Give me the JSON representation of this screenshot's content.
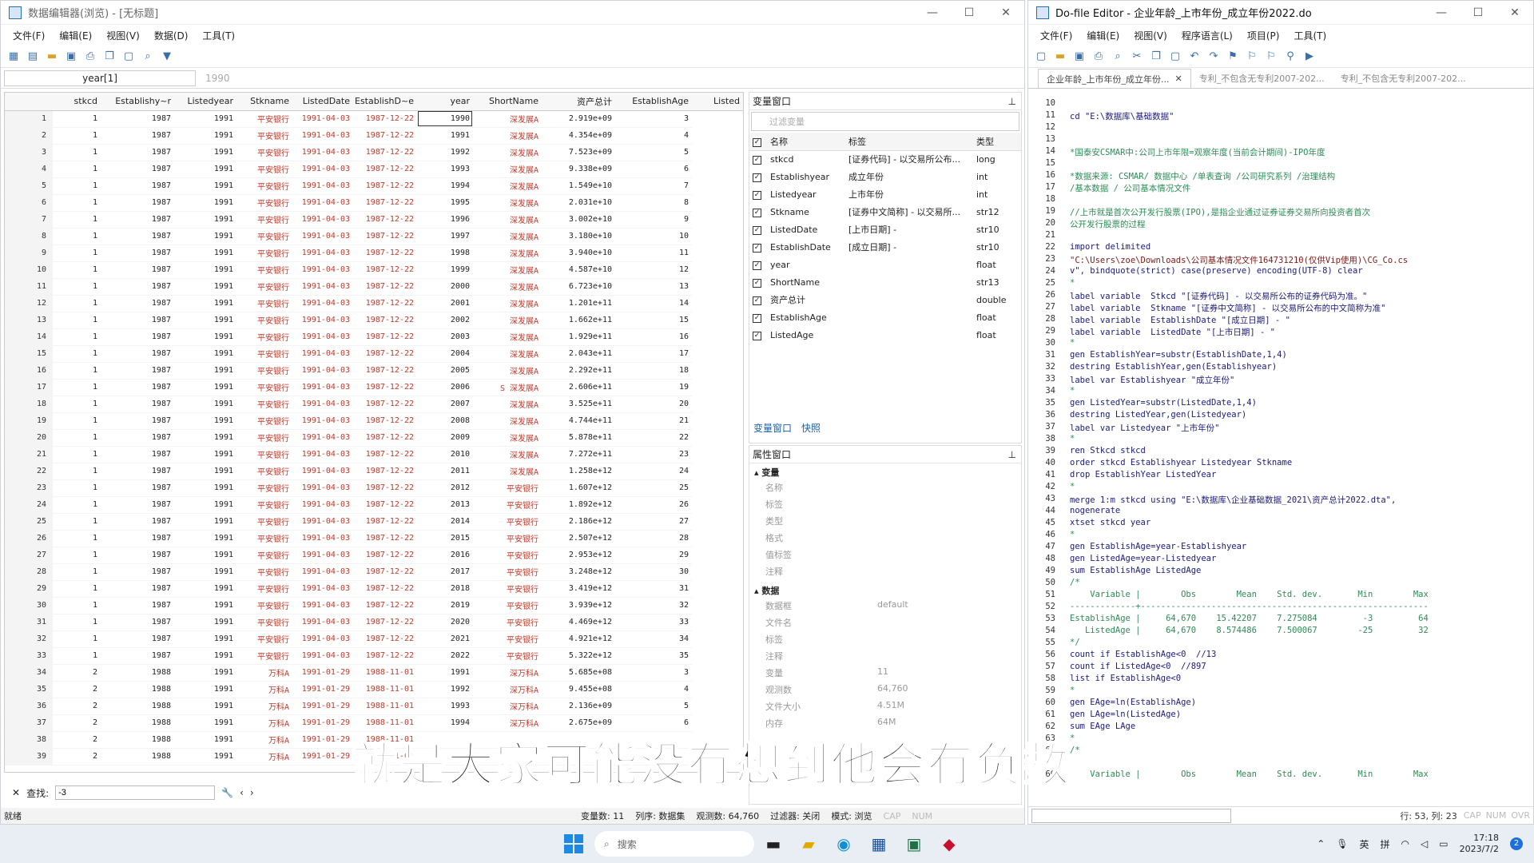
{
  "data_editor": {
    "title": "数据编辑器(浏览) - [无标题]",
    "menu": [
      "文件(F)",
      "编辑(E)",
      "视图(V)",
      "数据(D)",
      "工具(T)"
    ],
    "cell_ref": "year[1]",
    "cell_value": "1990",
    "columns": [
      "stkcd",
      "Establishy~r",
      "Listedyear",
      "Stkname",
      "ListedDate",
      "EstablishD~e",
      "year",
      "ShortName",
      "资产总计",
      "EstablishAge",
      "Listed"
    ],
    "rows": [
      [
        "1",
        "1",
        "1987",
        "1991",
        "平安银行",
        "1991-04-03",
        "1987-12-22",
        "1990",
        "深发展A",
        "2.919e+09",
        "3"
      ],
      [
        "2",
        "1",
        "1987",
        "1991",
        "平安银行",
        "1991-04-03",
        "1987-12-22",
        "1991",
        "深发展A",
        "4.354e+09",
        "4"
      ],
      [
        "3",
        "1",
        "1987",
        "1991",
        "平安银行",
        "1991-04-03",
        "1987-12-22",
        "1992",
        "深发展A",
        "7.523e+09",
        "5"
      ],
      [
        "4",
        "1",
        "1987",
        "1991",
        "平安银行",
        "1991-04-03",
        "1987-12-22",
        "1993",
        "深发展A",
        "9.338e+09",
        "6"
      ],
      [
        "5",
        "1",
        "1987",
        "1991",
        "平安银行",
        "1991-04-03",
        "1987-12-22",
        "1994",
        "深发展A",
        "1.549e+10",
        "7"
      ],
      [
        "6",
        "1",
        "1987",
        "1991",
        "平安银行",
        "1991-04-03",
        "1987-12-22",
        "1995",
        "深发展A",
        "2.031e+10",
        "8"
      ],
      [
        "7",
        "1",
        "1987",
        "1991",
        "平安银行",
        "1991-04-03",
        "1987-12-22",
        "1996",
        "深发展A",
        "3.002e+10",
        "9"
      ],
      [
        "8",
        "1",
        "1987",
        "1991",
        "平安银行",
        "1991-04-03",
        "1987-12-22",
        "1997",
        "深发展A",
        "3.180e+10",
        "10"
      ],
      [
        "9",
        "1",
        "1987",
        "1991",
        "平安银行",
        "1991-04-03",
        "1987-12-22",
        "1998",
        "深发展A",
        "3.940e+10",
        "11"
      ],
      [
        "10",
        "1",
        "1987",
        "1991",
        "平安银行",
        "1991-04-03",
        "1987-12-22",
        "1999",
        "深发展A",
        "4.587e+10",
        "12"
      ],
      [
        "11",
        "1",
        "1987",
        "1991",
        "平安银行",
        "1991-04-03",
        "1987-12-22",
        "2000",
        "深发展A",
        "6.723e+10",
        "13"
      ],
      [
        "12",
        "1",
        "1987",
        "1991",
        "平安银行",
        "1991-04-03",
        "1987-12-22",
        "2001",
        "深发展A",
        "1.201e+11",
        "14"
      ],
      [
        "13",
        "1",
        "1987",
        "1991",
        "平安银行",
        "1991-04-03",
        "1987-12-22",
        "2002",
        "深发展A",
        "1.662e+11",
        "15"
      ],
      [
        "14",
        "1",
        "1987",
        "1991",
        "平安银行",
        "1991-04-03",
        "1987-12-22",
        "2003",
        "深发展A",
        "1.929e+11",
        "16"
      ],
      [
        "15",
        "1",
        "1987",
        "1991",
        "平安银行",
        "1991-04-03",
        "1987-12-22",
        "2004",
        "深发展A",
        "2.043e+11",
        "17"
      ],
      [
        "16",
        "1",
        "1987",
        "1991",
        "平安银行",
        "1991-04-03",
        "1987-12-22",
        "2005",
        "深发展A",
        "2.292e+11",
        "18"
      ],
      [
        "17",
        "1",
        "1987",
        "1991",
        "平安银行",
        "1991-04-03",
        "1987-12-22",
        "2006",
        "S 深发展A",
        "2.606e+11",
        "19"
      ],
      [
        "18",
        "1",
        "1987",
        "1991",
        "平安银行",
        "1991-04-03",
        "1987-12-22",
        "2007",
        "深发展A",
        "3.525e+11",
        "20"
      ],
      [
        "19",
        "1",
        "1987",
        "1991",
        "平安银行",
        "1991-04-03",
        "1987-12-22",
        "2008",
        "深发展A",
        "4.744e+11",
        "21"
      ],
      [
        "20",
        "1",
        "1987",
        "1991",
        "平安银行",
        "1991-04-03",
        "1987-12-22",
        "2009",
        "深发展A",
        "5.878e+11",
        "22"
      ],
      [
        "21",
        "1",
        "1987",
        "1991",
        "平安银行",
        "1991-04-03",
        "1987-12-22",
        "2010",
        "深发展A",
        "7.272e+11",
        "23"
      ],
      [
        "22",
        "1",
        "1987",
        "1991",
        "平安银行",
        "1991-04-03",
        "1987-12-22",
        "2011",
        "深发展A",
        "1.258e+12",
        "24"
      ],
      [
        "23",
        "1",
        "1987",
        "1991",
        "平安银行",
        "1991-04-03",
        "1987-12-22",
        "2012",
        "平安银行",
        "1.607e+12",
        "25"
      ],
      [
        "24",
        "1",
        "1987",
        "1991",
        "平安银行",
        "1991-04-03",
        "1987-12-22",
        "2013",
        "平安银行",
        "1.892e+12",
        "26"
      ],
      [
        "25",
        "1",
        "1987",
        "1991",
        "平安银行",
        "1991-04-03",
        "1987-12-22",
        "2014",
        "平安银行",
        "2.186e+12",
        "27"
      ],
      [
        "26",
        "1",
        "1987",
        "1991",
        "平安银行",
        "1991-04-03",
        "1987-12-22",
        "2015",
        "平安银行",
        "2.507e+12",
        "28"
      ],
      [
        "27",
        "1",
        "1987",
        "1991",
        "平安银行",
        "1991-04-03",
        "1987-12-22",
        "2016",
        "平安银行",
        "2.953e+12",
        "29"
      ],
      [
        "28",
        "1",
        "1987",
        "1991",
        "平安银行",
        "1991-04-03",
        "1987-12-22",
        "2017",
        "平安银行",
        "3.248e+12",
        "30"
      ],
      [
        "29",
        "1",
        "1987",
        "1991",
        "平安银行",
        "1991-04-03",
        "1987-12-22",
        "2018",
        "平安银行",
        "3.419e+12",
        "31"
      ],
      [
        "30",
        "1",
        "1987",
        "1991",
        "平安银行",
        "1991-04-03",
        "1987-12-22",
        "2019",
        "平安银行",
        "3.939e+12",
        "32"
      ],
      [
        "31",
        "1",
        "1987",
        "1991",
        "平安银行",
        "1991-04-03",
        "1987-12-22",
        "2020",
        "平安银行",
        "4.469e+12",
        "33"
      ],
      [
        "32",
        "1",
        "1987",
        "1991",
        "平安银行",
        "1991-04-03",
        "1987-12-22",
        "2021",
        "平安银行",
        "4.921e+12",
        "34"
      ],
      [
        "33",
        "1",
        "1987",
        "1991",
        "平安银行",
        "1991-04-03",
        "1987-12-22",
        "2022",
        "平安银行",
        "5.322e+12",
        "35"
      ],
      [
        "34",
        "2",
        "1988",
        "1991",
        "万科A",
        "1991-01-29",
        "1988-11-01",
        "1991",
        "深万科A",
        "5.685e+08",
        "3"
      ],
      [
        "35",
        "2",
        "1988",
        "1991",
        "万科A",
        "1991-01-29",
        "1988-11-01",
        "1992",
        "深万科A",
        "9.455e+08",
        "4"
      ],
      [
        "36",
        "2",
        "1988",
        "1991",
        "万科A",
        "1991-01-29",
        "1988-11-01",
        "1993",
        "深万科A",
        "2.136e+09",
        "5"
      ],
      [
        "37",
        "2",
        "1988",
        "1991",
        "万科A",
        "1991-01-29",
        "1988-11-01",
        "1994",
        "深万科A",
        "2.675e+09",
        "6"
      ],
      [
        "38",
        "2",
        "1988",
        "1991",
        "万科A",
        "1991-01-29",
        "1988-11-01",
        "",
        "",
        "",
        ""
      ],
      [
        "39",
        "2",
        "1988",
        "1991",
        "万科A",
        "1991-01-29",
        "1988-11-01",
        "",
        "",
        "",
        ""
      ]
    ],
    "find_label": "查找:",
    "find_value": "-3",
    "status": [
      "就绪",
      "变量数: 11",
      "列序: 数据集",
      "观测数: 64,760",
      "过滤器: 关闭",
      "模式: 浏览",
      "CAP",
      "NUM"
    ],
    "var_window": {
      "title": "变量窗口",
      "filter_placeholder": "过滤变量",
      "headers": [
        "名称",
        "标签",
        "类型"
      ],
      "vars": [
        [
          "stkcd",
          "[证券代码] - 以交易所公布...",
          "long"
        ],
        [
          "Establishyear",
          "成立年份",
          "int"
        ],
        [
          "Listedyear",
          "上市年份",
          "int"
        ],
        [
          "Stkname",
          "[证券中文简称] - 以交易所...",
          "str12"
        ],
        [
          "ListedDate",
          "[上市日期] -",
          "str10"
        ],
        [
          "EstablishDate",
          "[成立日期] -",
          "str10"
        ],
        [
          "year",
          "",
          "float"
        ],
        [
          "ShortName",
          "",
          "str13"
        ],
        [
          "资产总计",
          "",
          "double"
        ],
        [
          "EstablishAge",
          "",
          "float"
        ],
        [
          "ListedAge",
          "",
          "float"
        ]
      ],
      "tabs": [
        "变量窗口",
        "快照"
      ]
    },
    "props": {
      "title": "属性窗口",
      "sec_var": "变量",
      "var_keys": [
        "名称",
        "标签",
        "类型",
        "格式",
        "值标签",
        "注释"
      ],
      "sec_data": "数据",
      "data_rows": [
        [
          "数据框",
          "default"
        ],
        [
          "文件名",
          ""
        ],
        [
          "标签",
          ""
        ],
        [
          "注释",
          ""
        ],
        [
          "变量",
          "11"
        ],
        [
          "观测数",
          "64,760"
        ],
        [
          "文件大小",
          "4.51M"
        ],
        [
          "内存",
          "64M"
        ]
      ]
    }
  },
  "do_editor": {
    "title": "Do-file Editor - 企业年龄_上市年份_成立年份2022.do",
    "menu": [
      "文件(F)",
      "编辑(E)",
      "视图(V)",
      "程序语言(L)",
      "项目(P)",
      "工具(T)"
    ],
    "tabs": [
      "企业年龄_上市年份_成立年份...",
      "专利_不包含无专利2007-202...",
      "专利_不包含无专利2007-202..."
    ],
    "lines": [
      [
        "10",
        "",
        ""
      ],
      [
        "11",
        "cd \"E:\\数据库\\基础数据\"",
        ""
      ],
      [
        "12",
        "",
        ""
      ],
      [
        "13",
        "",
        ""
      ],
      [
        "14",
        "*国泰安CSMAR中:公司上市年限=观察年度(当前会计期间)-IPO年度",
        "c"
      ],
      [
        "15",
        "",
        ""
      ],
      [
        "16",
        "*数据来源: CSMAR/ 数据中心 /单表查询 /公司研究系列 /治理结构",
        "c"
      ],
      [
        "17",
        "/基本数据 / 公司基本情况文件",
        "c"
      ],
      [
        "18",
        "",
        ""
      ],
      [
        "19",
        "//上市就是首次公开发行股票(IPO),是指企业通过证券证券交易所向投资者首次",
        "c"
      ],
      [
        "20",
        "公开发行股票的过程",
        "c"
      ],
      [
        "21",
        "",
        ""
      ],
      [
        "22",
        "import delimited",
        ""
      ],
      [
        "23",
        "\"C:\\Users\\zoe\\Downloads\\公司基本情况文件164731210(仅供Vip使用)\\CG_Co.cs",
        "s"
      ],
      [
        "24",
        "v\", bindquote(strict) case(preserve) encoding(UTF-8) clear",
        ""
      ],
      [
        "25",
        "*",
        "c"
      ],
      [
        "26",
        "label variable  Stkcd \"[证券代码] - 以交易所公布的证券代码为准。\"",
        ""
      ],
      [
        "27",
        "label variable  Stkname \"[证券中文简称] - 以交易所公布的中文简称为准\"",
        ""
      ],
      [
        "28",
        "label variable  EstablishDate \"[成立日期] - \"",
        ""
      ],
      [
        "29",
        "label variable  ListedDate \"[上市日期] - \"",
        ""
      ],
      [
        "30",
        "*",
        "c"
      ],
      [
        "31",
        "gen EstablishYear=substr(EstablishDate,1,4)",
        ""
      ],
      [
        "32",
        "destring EstablishYear,gen(Establishyear)",
        ""
      ],
      [
        "33",
        "label var Establishyear \"成立年份\"",
        ""
      ],
      [
        "34",
        "*",
        "c"
      ],
      [
        "35",
        "gen ListedYear=substr(ListedDate,1,4)",
        ""
      ],
      [
        "36",
        "destring ListedYear,gen(Listedyear)",
        ""
      ],
      [
        "37",
        "label var Listedyear \"上市年份\"",
        ""
      ],
      [
        "38",
        "*",
        "c"
      ],
      [
        "39",
        "ren Stkcd stkcd",
        ""
      ],
      [
        "40",
        "order stkcd Establishyear Listedyear Stkname",
        ""
      ],
      [
        "41",
        "drop EstablishYear ListedYear",
        ""
      ],
      [
        "42",
        "*",
        "c"
      ],
      [
        "43",
        "merge 1:m stkcd using \"E:\\数据库\\企业基础数据_2021\\资产总计2022.dta\",",
        ""
      ],
      [
        "44",
        "nogenerate",
        ""
      ],
      [
        "45",
        "xtset stkcd year",
        ""
      ],
      [
        "46",
        "*",
        "c"
      ],
      [
        "47",
        "gen EstablishAge=year-Establishyear",
        ""
      ],
      [
        "48",
        "gen ListedAge=year-Listedyear",
        ""
      ],
      [
        "49",
        "sum EstablishAge ListedAge",
        ""
      ],
      [
        "50",
        "/*",
        "c"
      ],
      [
        "51",
        "    Variable |        Obs        Mean    Std. dev.       Min        Max",
        "c"
      ],
      [
        "52",
        "-------------+---------------------------------------------------------",
        "c"
      ],
      [
        "53",
        "EstablishAge |     64,670    15.42207    7.275084         -3         64",
        "c"
      ],
      [
        "54",
        "   ListedAge |     64,670    8.574486    7.500067        -25         32",
        "c"
      ],
      [
        "55",
        "*/",
        "c"
      ],
      [
        "56",
        "count if EstablishAge<0  //13",
        ""
      ],
      [
        "57",
        "count if ListedAge<0  //897",
        ""
      ],
      [
        "58",
        "list if EstablishAge<0",
        ""
      ],
      [
        "59",
        "*",
        "c"
      ],
      [
        "60",
        "gen EAge=ln(EstablishAge)",
        ""
      ],
      [
        "61",
        "gen LAge=ln(ListedAge)",
        ""
      ],
      [
        "62",
        "sum EAge LAge",
        ""
      ],
      [
        "63",
        "*",
        "c"
      ],
      [
        "64",
        "/*",
        "c"
      ],
      [
        "65",
        "",
        "c"
      ],
      [
        "66",
        "    Variable |        Obs        Mean    Std. dev.       Min        Max",
        "c"
      ]
    ],
    "position": "行: 53, 列: 23",
    "indicators": [
      "CAP",
      "NUM",
      "OVR"
    ]
  },
  "subtitle": "就是大家可能没有想到他会有负数",
  "taskbar": {
    "search": "搜索",
    "lang1": "英",
    "lang2": "拼",
    "time": "17:18",
    "date": "2023/7/2",
    "badge": "2"
  }
}
